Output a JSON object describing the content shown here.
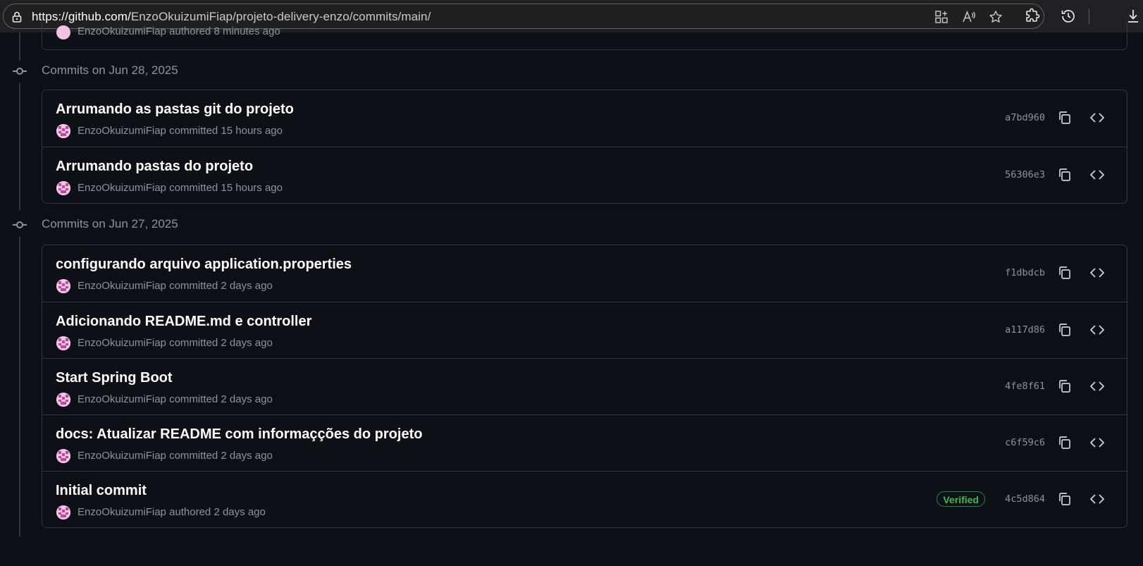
{
  "browser": {
    "url_host": "https://github.com/",
    "url_path": "EnzoOkuizumiFiap/projeto-delivery-enzo/commits/main/",
    "icons": [
      "lock-icon",
      "tab-actions-icon",
      "read-aloud-icon",
      "favorite-star-icon",
      "extensions-icon",
      "history-icon",
      "downloads-icon"
    ]
  },
  "top_partial": {
    "author": "EnzoOkuizumiFiap",
    "action": "authored",
    "time": "8 minutes ago"
  },
  "groups": [
    {
      "title": "Commits on Jun 28, 2025",
      "commits": [
        {
          "message": "Arrumando as pastas git do projeto",
          "author": "EnzoOkuizumiFiap",
          "action": "committed",
          "time": "15 hours ago",
          "sha": "a7bd960",
          "verified": ""
        },
        {
          "message": "Arrumando pastas do projeto",
          "author": "EnzoOkuizumiFiap",
          "action": "committed",
          "time": "15 hours ago",
          "sha": "56306e3",
          "verified": ""
        }
      ]
    },
    {
      "title": "Commits on Jun 27, 2025",
      "commits": [
        {
          "message": "configurando arquivo application.properties",
          "author": "EnzoOkuizumiFiap",
          "action": "committed",
          "time": "2 days ago",
          "sha": "f1dbdcb",
          "verified": ""
        },
        {
          "message": "Adicionando README.md e controller",
          "author": "EnzoOkuizumiFiap",
          "action": "committed",
          "time": "2 days ago",
          "sha": "a117d86",
          "verified": ""
        },
        {
          "message": "Start Spring Boot",
          "author": "EnzoOkuizumiFiap",
          "action": "committed",
          "time": "2 days ago",
          "sha": "4fe8f61",
          "verified": ""
        },
        {
          "message": "docs: Atualizar README com informaçções do projeto",
          "author": "EnzoOkuizumiFiap",
          "action": "committed",
          "time": "2 days ago",
          "sha": "c6f59c6",
          "verified": ""
        },
        {
          "message": "Initial commit",
          "author": "EnzoOkuizumiFiap",
          "action": "authored",
          "time": "2 days ago",
          "sha": "4c5d864",
          "verified": "Verified"
        }
      ]
    }
  ],
  "colors": {
    "background": "#0d1117",
    "border": "#30363d",
    "muted": "#8b949e",
    "verified": "#3fb950"
  }
}
